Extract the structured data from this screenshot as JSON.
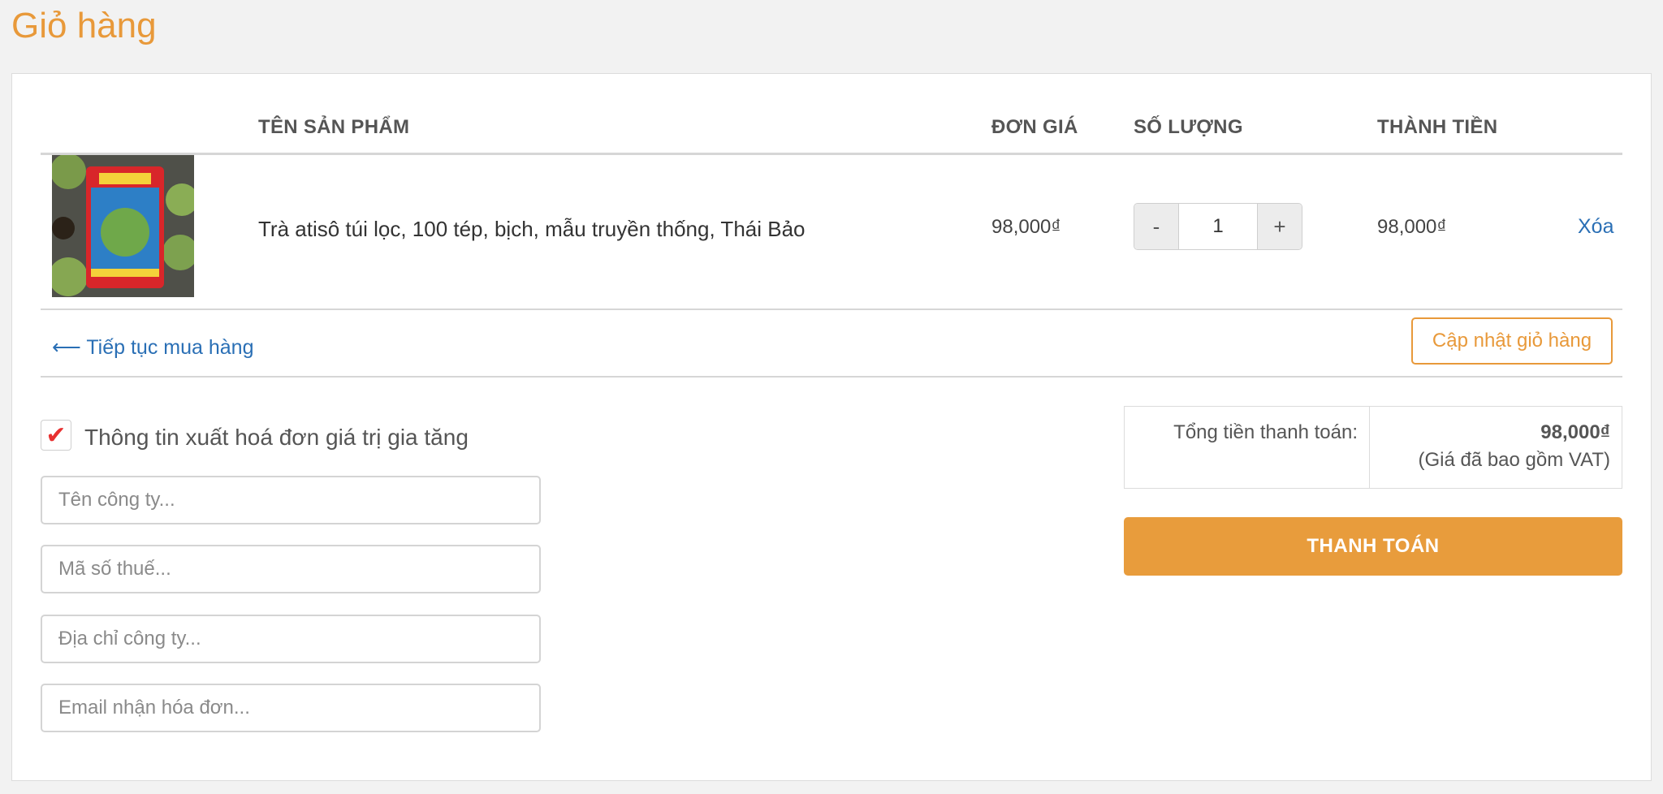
{
  "page": {
    "title": "Giỏ hàng"
  },
  "table": {
    "headers": {
      "product": "TÊN SẢN PHẨM",
      "unit_price": "ĐƠN GIÁ",
      "quantity": "SỐ LƯỢNG",
      "subtotal": "THÀNH TIỀN"
    },
    "rows": [
      {
        "name": "Trà atisô túi lọc, 100 tép, bịch, mẫu truyền thống, Thái Bảo",
        "unit_price": "98,000₫",
        "quantity": "1",
        "minus": "-",
        "plus": "+",
        "subtotal": "98,000₫",
        "remove": "Xóa"
      }
    ]
  },
  "actions": {
    "continue_shopping": "⟵ Tiếp tục mua hàng",
    "update_cart": "Cập nhật giỏ hàng"
  },
  "vat": {
    "checked": true,
    "label": "Thông tin xuất hoá đơn giá trị gia tăng",
    "company_placeholder": "Tên công ty...",
    "tax_code_placeholder": "Mã số thuế...",
    "address_placeholder": "Địa chỉ công ty...",
    "email_placeholder": "Email nhận hóa đơn..."
  },
  "summary": {
    "total_label": "Tổng tiền thanh toán:",
    "total_value": "98,000₫",
    "vat_note": "(Giá đã bao gồm VAT)",
    "checkout": "THANH TOÁN"
  },
  "colors": {
    "accent": "#e8993a",
    "link": "#2a6fb5",
    "check": "#e83030"
  }
}
